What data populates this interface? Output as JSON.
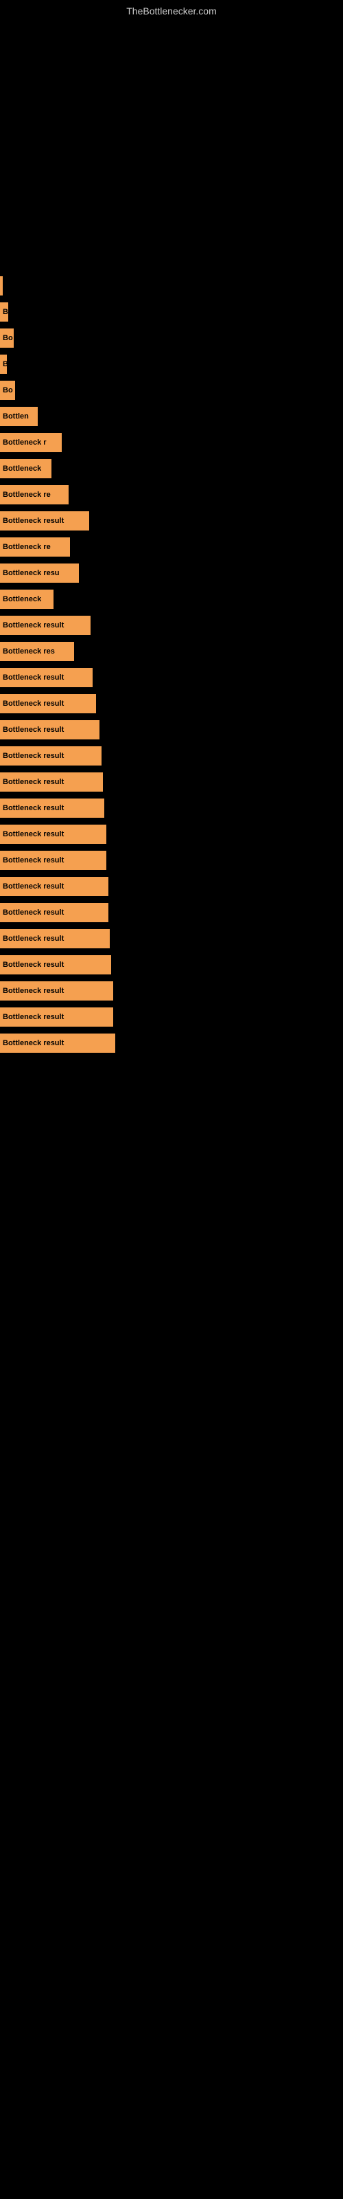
{
  "site": {
    "title": "TheBottlenecker.com"
  },
  "bars": [
    {
      "label": "",
      "width": 4
    },
    {
      "label": "B",
      "width": 12
    },
    {
      "label": "Bo",
      "width": 20
    },
    {
      "label": "B",
      "width": 10
    },
    {
      "label": "Bo",
      "width": 22
    },
    {
      "label": "Bottlen",
      "width": 55
    },
    {
      "label": "Bottleneck r",
      "width": 90
    },
    {
      "label": "Bottleneck",
      "width": 75
    },
    {
      "label": "Bottleneck re",
      "width": 100
    },
    {
      "label": "Bottleneck result",
      "width": 130
    },
    {
      "label": "Bottleneck re",
      "width": 102
    },
    {
      "label": "Bottleneck resu",
      "width": 115
    },
    {
      "label": "Bottleneck",
      "width": 78
    },
    {
      "label": "Bottleneck result",
      "width": 132
    },
    {
      "label": "Bottleneck res",
      "width": 108
    },
    {
      "label": "Bottleneck result",
      "width": 135
    },
    {
      "label": "Bottleneck result",
      "width": 140
    },
    {
      "label": "Bottleneck result",
      "width": 145
    },
    {
      "label": "Bottleneck result",
      "width": 148
    },
    {
      "label": "Bottleneck result",
      "width": 150
    },
    {
      "label": "Bottleneck result",
      "width": 152
    },
    {
      "label": "Bottleneck result",
      "width": 155
    },
    {
      "label": "Bottleneck result",
      "width": 155
    },
    {
      "label": "Bottleneck result",
      "width": 158
    },
    {
      "label": "Bottleneck result",
      "width": 158
    },
    {
      "label": "Bottleneck result",
      "width": 160
    },
    {
      "label": "Bottleneck result",
      "width": 162
    },
    {
      "label": "Bottleneck result",
      "width": 165
    },
    {
      "label": "Bottleneck result",
      "width": 165
    },
    {
      "label": "Bottleneck result",
      "width": 168
    }
  ]
}
